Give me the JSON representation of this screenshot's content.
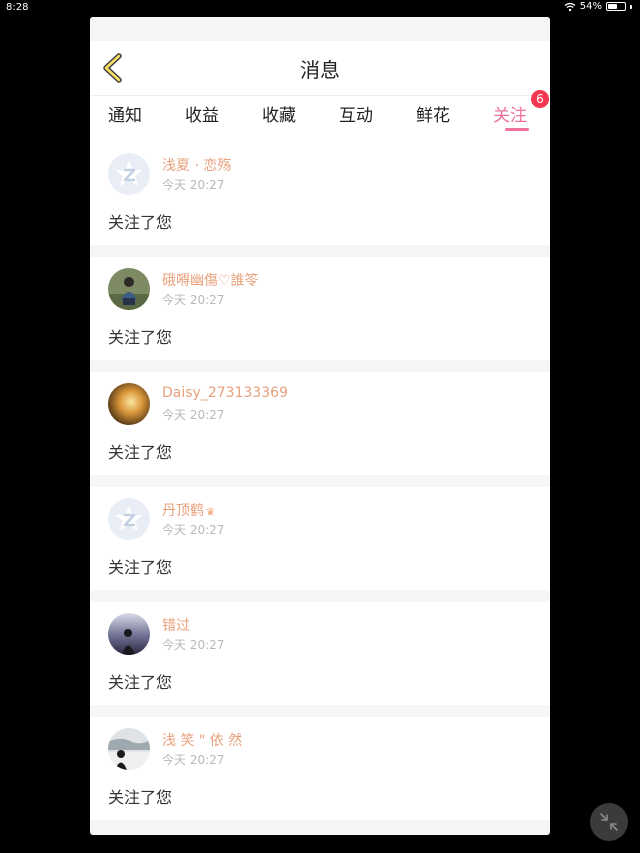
{
  "status_bar": {
    "time": "8:28",
    "battery": "54%",
    "battery_level": 0.54
  },
  "header": {
    "title": "消息"
  },
  "tabs": [
    {
      "label": "通知"
    },
    {
      "label": "收益"
    },
    {
      "label": "收藏"
    },
    {
      "label": "互动"
    },
    {
      "label": "鲜花"
    },
    {
      "label": "关注",
      "active": true,
      "badge": "6"
    }
  ],
  "notifications": [
    {
      "username": "浅夏 · 恋殇",
      "time": "今天 20:27",
      "message": "关注了您",
      "avatar": "default-avatar"
    },
    {
      "username": "硪嘚幽傷♡誰笭",
      "time": "今天 20:27",
      "message": "关注了您",
      "avatar": "photo-avatar"
    },
    {
      "username": "Daisy_273133369",
      "time": "今天 20:27",
      "message": "关注了您",
      "avatar": "photo-avatar"
    },
    {
      "username": "丹顶鹤",
      "time": "今天 20:27",
      "message": "关注了您",
      "avatar": "default-avatar",
      "crown": "♛"
    },
    {
      "username": "错过",
      "time": "今天 20:27",
      "message": "关注了您",
      "avatar": "photo-avatar"
    },
    {
      "username": "浅 笑 \" 依 然",
      "time": "今天 20:27",
      "message": "关注了您",
      "avatar": "photo-avatar"
    }
  ],
  "colors": {
    "accent": "#ef6f9f",
    "username": "#e9a07c",
    "badge": "#f33750"
  }
}
